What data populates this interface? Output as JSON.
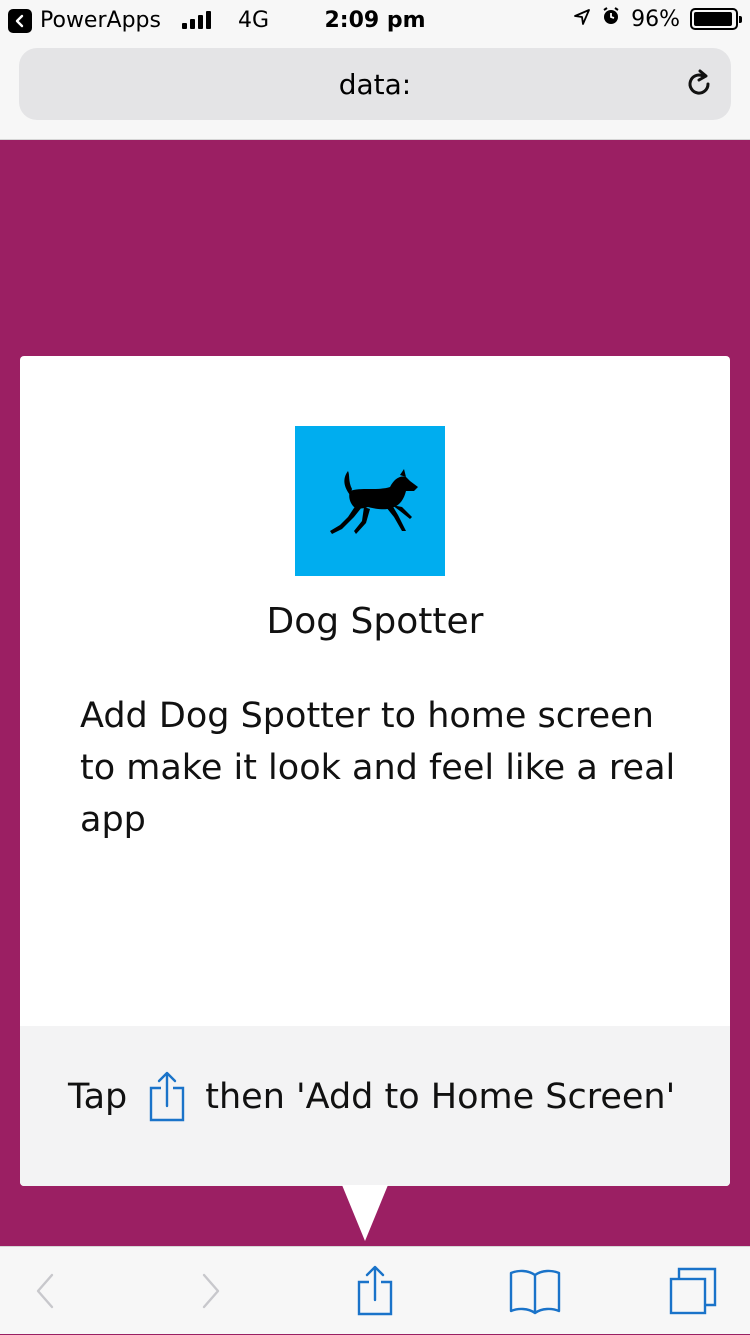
{
  "status_bar": {
    "back_app": "PowerApps",
    "network": "4G",
    "time": "2:09 pm",
    "battery": "96%",
    "battery_level": 0.96,
    "icons": [
      "signal-bars-icon",
      "location-arrow-icon",
      "alarm-icon",
      "battery-icon"
    ]
  },
  "address_bar": {
    "url": "data:",
    "reload_icon": "reload-icon"
  },
  "card": {
    "icon": "dog-icon",
    "icon_bg": "#00adef",
    "title": "Dog Spotter",
    "description": "Add Dog Spotter to home screen to make it look and feel like a real app",
    "tap_before": "Tap",
    "tap_after": "then 'Add to Home Screen'"
  },
  "toolbar": {
    "items": [
      "back-icon",
      "forward-icon",
      "share-icon",
      "bookmarks-icon",
      "tabs-icon"
    ]
  },
  "colors": {
    "background": "#9b1f63",
    "accent": "#1a73c9"
  }
}
